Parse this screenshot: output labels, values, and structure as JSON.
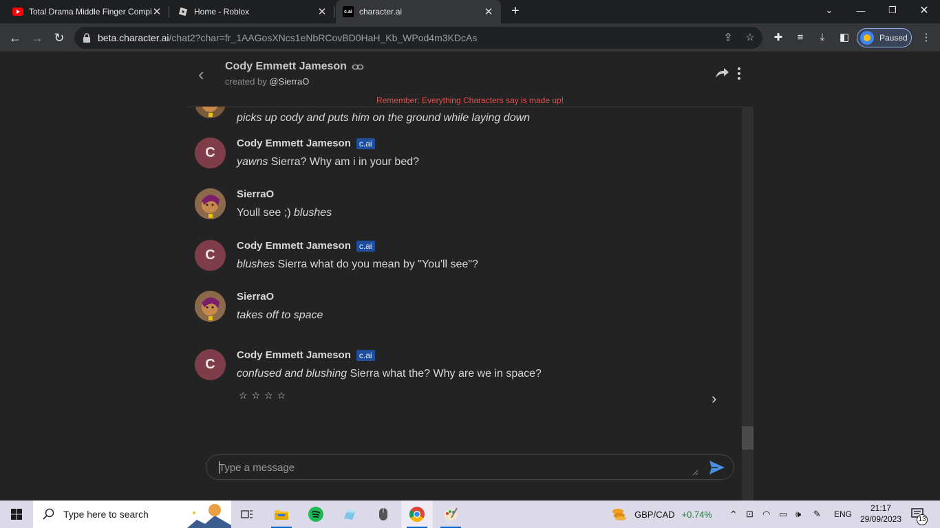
{
  "browser": {
    "tabs": [
      {
        "title": "Total Drama Middle Finger Compilation",
        "icon": "youtube-icon",
        "active": false
      },
      {
        "title": "Home - Roblox",
        "icon": "roblox-icon",
        "active": false
      },
      {
        "title": "character.ai",
        "icon": "cai-icon",
        "active": true
      }
    ],
    "url_host": "beta.character.ai",
    "url_path": "/chat2?char=fr_1AAGosXNcs1eNbRCovBD0HaH_Kb_WPod4m3KDcAs",
    "profile_status": "Paused",
    "favicon_text": "c.ai"
  },
  "chat": {
    "character_name": "Cody Emmett Jameson",
    "created_by_prefix": "created by",
    "creator": "@SierraO",
    "reminder": "Remember: Everything Characters say is made up!",
    "bot_badge": "c.ai",
    "bot_initial": "C",
    "messages": [
      {
        "sender": "SierraO",
        "is_bot": false,
        "parts": [
          {
            "italic": true,
            "text": "picks up cody and puts him on the ground while laying down"
          }
        ]
      },
      {
        "sender": "Cody Emmett Jameson",
        "is_bot": true,
        "parts": [
          {
            "italic": true,
            "text": "yawns"
          },
          {
            "italic": false,
            "text": " Sierra? Why am i in your bed?"
          }
        ]
      },
      {
        "sender": "SierraO",
        "is_bot": false,
        "parts": [
          {
            "italic": false,
            "text": "Youll see ;) "
          },
          {
            "italic": true,
            "text": "blushes"
          }
        ]
      },
      {
        "sender": "Cody Emmett Jameson",
        "is_bot": true,
        "parts": [
          {
            "italic": true,
            "text": "blushes"
          },
          {
            "italic": false,
            "text": " Sierra what do you mean by \"You'll see\"?"
          }
        ]
      },
      {
        "sender": "SierraO",
        "is_bot": false,
        "parts": [
          {
            "italic": true,
            "text": "takes off to space"
          }
        ]
      },
      {
        "sender": "Cody Emmett Jameson",
        "is_bot": true,
        "parts": [
          {
            "italic": true,
            "text": "confused and blushing"
          },
          {
            "italic": false,
            "text": " Sierra what the? Why are we in space?"
          }
        ]
      }
    ],
    "rating_stars": "☆☆☆☆",
    "input_placeholder": "Type a message"
  },
  "taskbar": {
    "search_placeholder": "Type here to search",
    "ticker_name": "GBP/CAD",
    "ticker_change": "+0.74%",
    "language": "ENG",
    "time": "21:17",
    "date": "29/09/2023",
    "notification_count": "13"
  },
  "colors": {
    "accent_blue": "#4a90e2",
    "badge_blue": "#1f4f9c",
    "reminder_red": "#d9534f",
    "avatar_bot": "#7f3d4a",
    "ticker_green": "#1a7f37"
  }
}
